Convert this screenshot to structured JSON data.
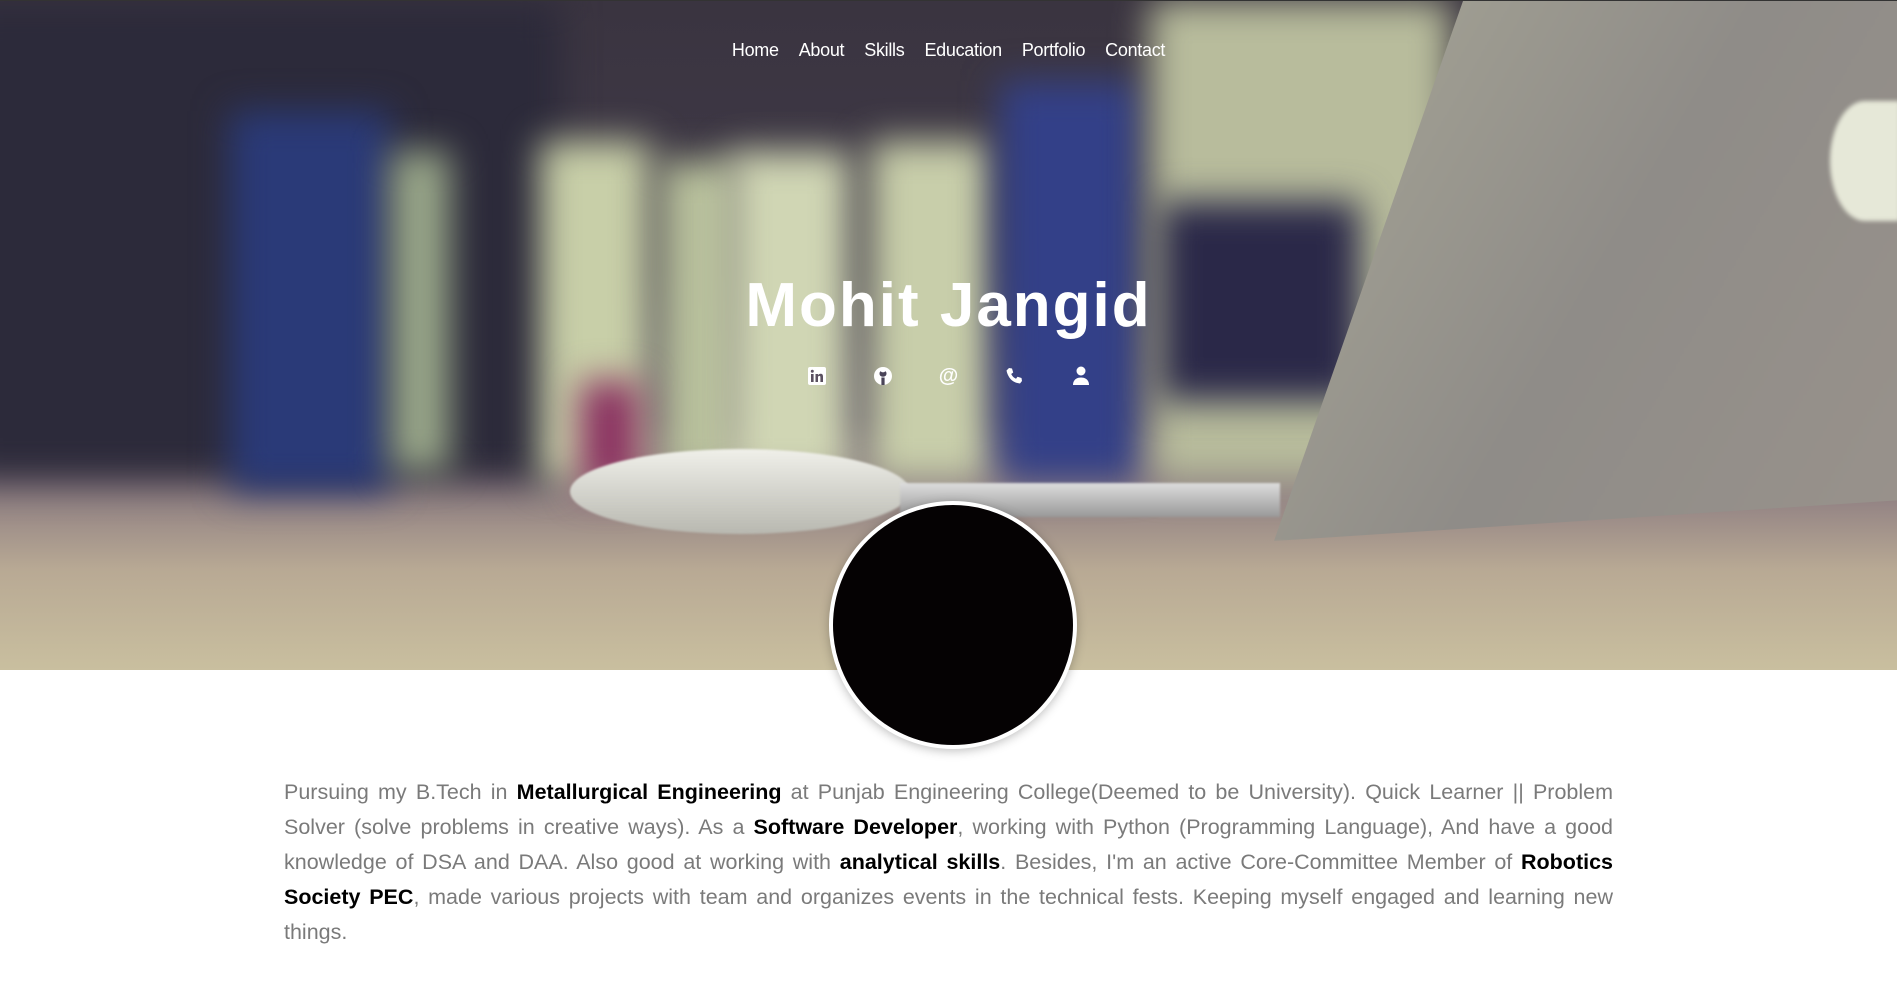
{
  "nav": {
    "items": [
      "Home",
      "About",
      "Skills",
      "Education",
      "Portfolio",
      "Contact"
    ]
  },
  "hero": {
    "title": "Mohit Jangid",
    "icons": [
      "linkedin-icon",
      "github-icon",
      "email-at-icon",
      "phone-icon",
      "user-icon"
    ]
  },
  "bio": {
    "t1": "Pursuing my B.Tech in ",
    "b1": "Metallurgical Engineering",
    "t2": " at Punjab Engineering College(Deemed to be University). Quick Learner || Problem Solver (solve problems in creative ways). As a ",
    "b2": "Software Developer",
    "t3": ", working with Python (Programming Language), And have a good knowledge of DSA and DAA. Also good at working with ",
    "b3": "analytical skills",
    "t4": ". Besides, I'm an active Core-Committee Member of ",
    "b4": "Robotics Society PEC",
    "t5": ", made various projects with team and organizes events in the technical fests. Keeping myself engaged and learning new things."
  }
}
